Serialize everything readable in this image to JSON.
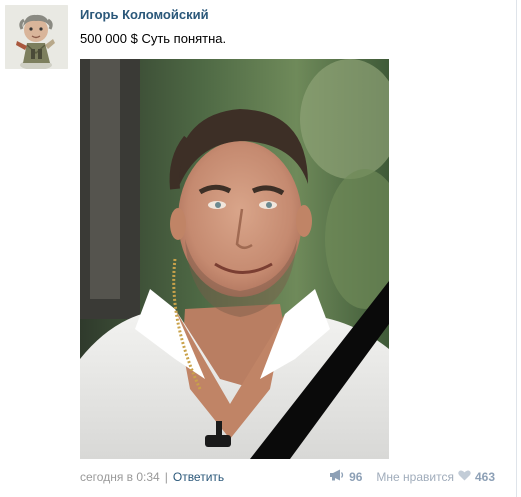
{
  "post": {
    "author": "Игорь Коломойский",
    "text": "500 000 $ Суть понятна.",
    "timestamp": "сегодня в 0:34",
    "separator": "|",
    "reply_label": "Ответить",
    "share_count": "96",
    "like_label": "Мне нравится",
    "like_count": "463"
  },
  "icons": {
    "share": "megaphone-icon",
    "like": "heart-icon"
  },
  "colors": {
    "link": "#2b587a",
    "meta_text": "#999999",
    "counter": "#8da0b6"
  }
}
